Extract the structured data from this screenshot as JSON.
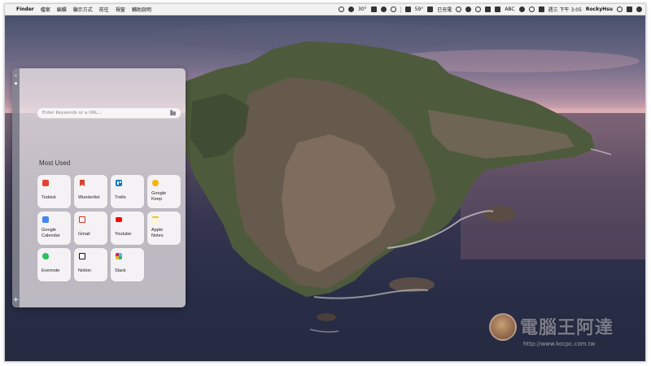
{
  "menubar": {
    "app_name": "Finder",
    "menus": [
      "檔案",
      "編輯",
      "顯示方式",
      "前往",
      "視窗",
      "輔助說明"
    ],
    "weather": "30°",
    "temperature": "59°",
    "status_text": "已充電",
    "input_method": "ABC",
    "datetime": "週三 下午 3:05",
    "user": "RockyHsu"
  },
  "panel": {
    "search_placeholder": "Enter Keywords or a URL...",
    "section_title": "Most Used",
    "add_label": "+",
    "collapse_label": "‹",
    "apps": [
      {
        "label": "Todoist",
        "icon": "todoist-icon"
      },
      {
        "label": "Wunderlist",
        "icon": "wunderlist-icon"
      },
      {
        "label": "Trello",
        "icon": "trello-icon"
      },
      {
        "label": "Google\nKeep",
        "icon": "google-keep-icon"
      },
      {
        "label": "Google\nCalendar",
        "icon": "google-calendar-icon"
      },
      {
        "label": "Gmail",
        "icon": "gmail-icon"
      },
      {
        "label": "Youtube",
        "icon": "youtube-icon"
      },
      {
        "label": "Apple\nNotes",
        "icon": "apple-notes-icon"
      },
      {
        "label": "Evernote",
        "icon": "evernote-icon"
      },
      {
        "label": "Notion",
        "icon": "notion-icon"
      },
      {
        "label": "Slack",
        "icon": "slack-icon"
      }
    ]
  },
  "watermark": {
    "logo_text": "電腦王阿達",
    "url": "http://www.kocpc.com.tw"
  }
}
